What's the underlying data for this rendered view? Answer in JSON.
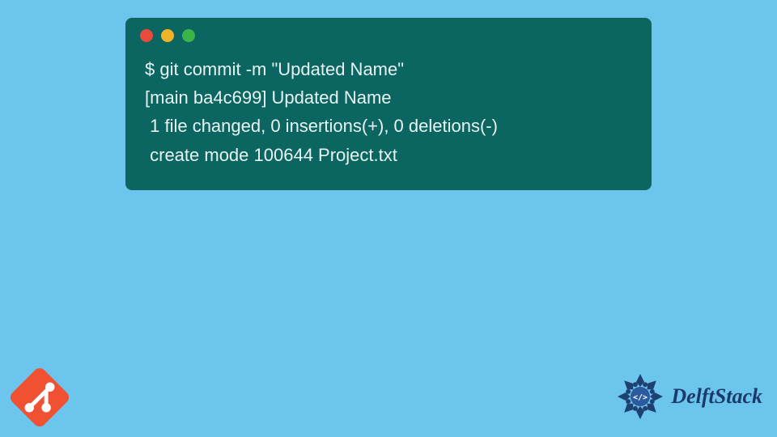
{
  "terminal": {
    "lines": [
      "$ git commit -m \"Updated Name\"",
      "[main ba4c699] Updated Name",
      " 1 file changed, 0 insertions(+), 0 deletions(-)",
      " create mode 100644 Project.txt"
    ]
  },
  "brand": {
    "name": "DelftStack"
  },
  "colors": {
    "background": "#6cc5ed",
    "terminal_bg": "#0b6560",
    "terminal_text": "#e8f4f3",
    "dot_red": "#e94b3c",
    "dot_yellow": "#f0b429",
    "dot_green": "#3bb54a",
    "git_orange": "#f05133",
    "brand_blue": "#1b3a6b"
  },
  "icons": {
    "git": "git-icon",
    "mandala": "mandala-icon"
  }
}
